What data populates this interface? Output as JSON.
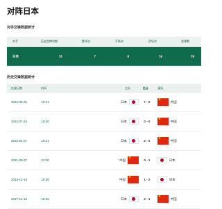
{
  "page_title": "对阵日本",
  "stats_section_title": "对手交锋数据统计",
  "stats_table": {
    "headers": [
      "对手",
      "历史交锋次数",
      "胜场次",
      "平场次",
      "负场次",
      "进球数"
    ],
    "row": [
      "日本",
      "31",
      "7",
      "8",
      "16",
      "29"
    ]
  },
  "history_section_title": "历史交锋数据统计",
  "history_table": {
    "headers": {
      "date": "比赛日期",
      "time": "时间",
      "home": "主队",
      "score": "比分",
      "away": "客队"
    },
    "rows": [
      {
        "date": "2024-09-05",
        "time": "18:41",
        "home": "日本",
        "home_flag": "jp-flag-icon",
        "score": "7 - 0",
        "away": "中国",
        "away_flag": "cn-flag-icon"
      },
      {
        "date": "2022-07-24",
        "time": "18:20",
        "home": "日本",
        "home_flag": "jp-flag-icon",
        "score": "0 - 0",
        "away": "中国",
        "away_flag": "cn-flag-icon"
      },
      {
        "date": "2022-01-27",
        "time": "18:21",
        "home": "日本",
        "home_flag": "jp-flag-icon",
        "score": "2 - 0",
        "away": "中国",
        "away_flag": "cn-flag-icon"
      },
      {
        "date": "2021-09-07",
        "time": "23:00",
        "home": "中国",
        "home_flag": "cn-flag-icon",
        "score": "0 - 1",
        "away": "日本",
        "away_flag": "jp-flag-icon"
      },
      {
        "date": "2019-12-10",
        "time": "18:30",
        "home": "中国",
        "home_flag": "cn-flag-icon",
        "score": "1 - 2",
        "away": "日本",
        "away_flag": "jp-flag-icon"
      },
      {
        "date": "2017-12-12",
        "time": "18:15",
        "home": "日本",
        "home_flag": "jp-flag-icon",
        "score": "2 - 1",
        "away": "中国",
        "away_flag": "cn-flag-icon"
      }
    ]
  },
  "colors": {
    "accent": "#0f6b4c",
    "header_bg": "#eaf1ee",
    "japan_red": "#bc002d",
    "china_red": "#de2910",
    "china_star": "#ffde00"
  }
}
